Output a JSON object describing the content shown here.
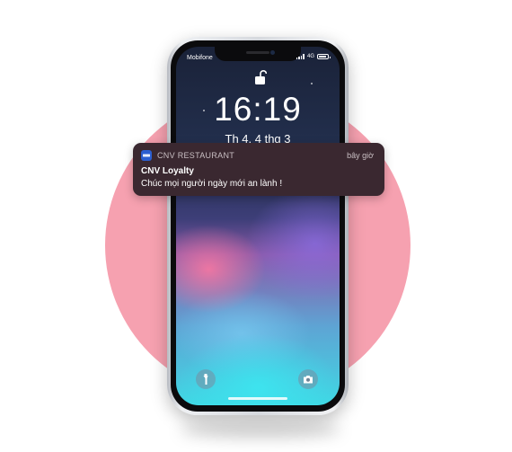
{
  "status_bar": {
    "carrier": "Mobifone",
    "network": "4G"
  },
  "lock_screen": {
    "time": "16:19",
    "date": "Th 4, 4 thg 3"
  },
  "notification": {
    "app_name": "CNV RESTAURANT",
    "timestamp": "bây giờ",
    "title": "CNV Loyalty",
    "body": "Chúc mọi người ngày mới an lành !"
  },
  "icons": {
    "lock": "unlock-icon",
    "flashlight": "flashlight-icon",
    "camera": "camera-icon"
  },
  "colors": {
    "background_circle": "#f6a1b0",
    "notification_bg": "#3a2830",
    "app_icon": "#2c5fd0"
  }
}
